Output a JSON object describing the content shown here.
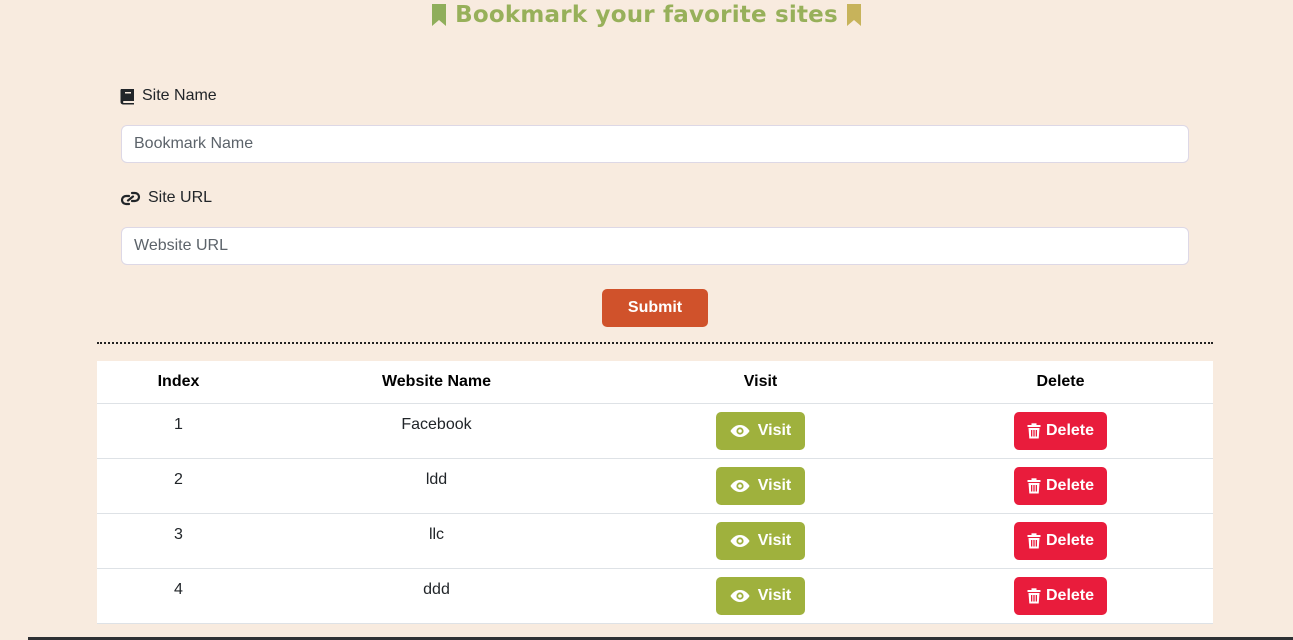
{
  "header": {
    "title": "Bookmark your favorite sites",
    "title_color": "#97b05a",
    "bookmark_icon_colors": [
      "#8fae5b",
      "#c7b35b"
    ]
  },
  "form": {
    "site_name": {
      "label": "Site Name",
      "icon": "book-icon",
      "placeholder": "Bookmark Name",
      "value": ""
    },
    "site_url": {
      "label": "Site URL",
      "icon": "link-icon",
      "placeholder": "Website URL",
      "value": ""
    },
    "submit_label": "Submit",
    "submit_color": "#d0522b"
  },
  "table": {
    "headers": [
      "Index",
      "Website Name",
      "Visit",
      "Delete"
    ],
    "rows": [
      {
        "index": "1",
        "name": "Facebook",
        "visit_label": "Visit",
        "delete_label": "Delete"
      },
      {
        "index": "2",
        "name": "ldd",
        "visit_label": "Visit",
        "delete_label": "Delete"
      },
      {
        "index": "3",
        "name": "llc",
        "visit_label": "Visit",
        "delete_label": "Delete"
      },
      {
        "index": "4",
        "name": "ddd",
        "visit_label": "Visit",
        "delete_label": "Delete"
      }
    ],
    "visit_color": "#9fb13d",
    "delete_color": "#e91c3c"
  }
}
